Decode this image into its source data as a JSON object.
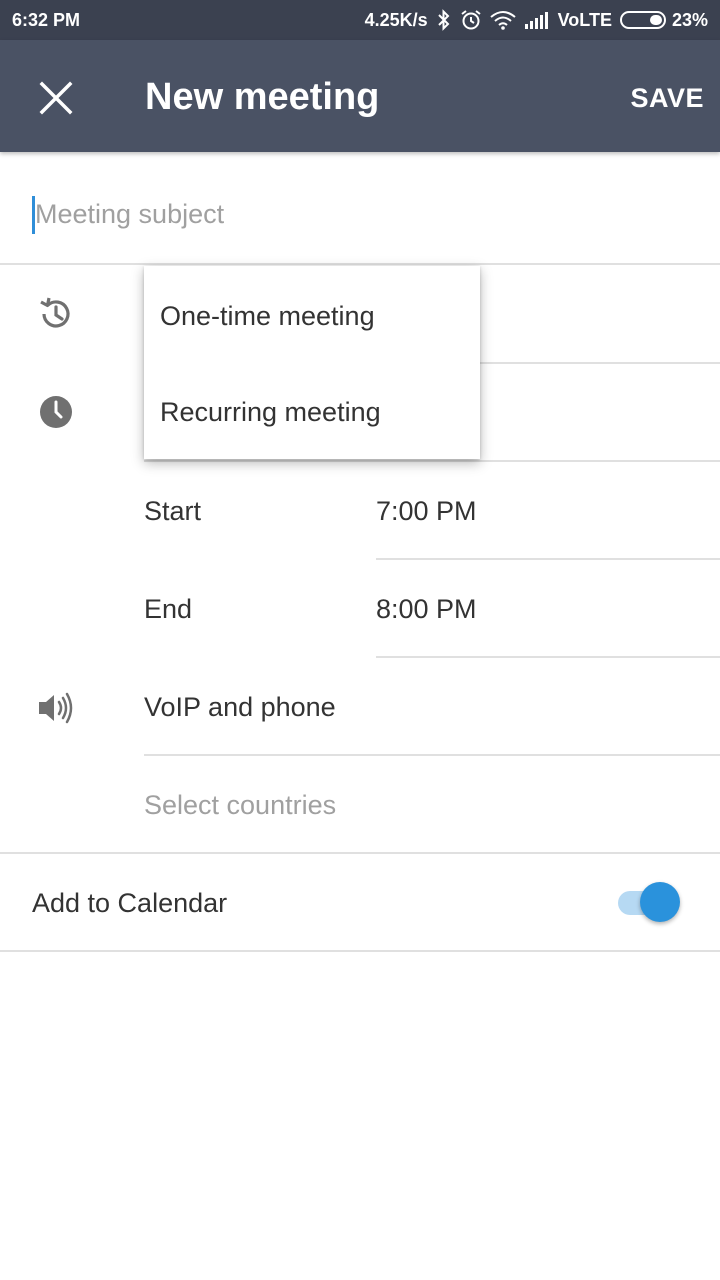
{
  "status_bar": {
    "time": "6:32 PM",
    "net_speed": "4.25K/s",
    "network": "VoLTE",
    "battery": "23%",
    "icons": [
      "bluetooth-icon",
      "alarm-icon",
      "wifi-icon",
      "signal-icon",
      "battery-icon"
    ]
  },
  "app_bar": {
    "title": "New meeting",
    "save_label": "SAVE",
    "background": "#4a5264"
  },
  "subject": {
    "placeholder": "Meeting subject",
    "value": ""
  },
  "meeting_type_menu": {
    "options": [
      "One-time meeting",
      "Recurring meeting"
    ]
  },
  "schedule": {
    "start_label": "Start",
    "start_time": "7:00 PM",
    "end_label": "End",
    "end_time": "8:00 PM"
  },
  "audio": {
    "label": "VoIP and phone",
    "countries_placeholder": "Select countries"
  },
  "calendar": {
    "label": "Add to Calendar",
    "enabled": true,
    "accent": "#2a92dc"
  }
}
